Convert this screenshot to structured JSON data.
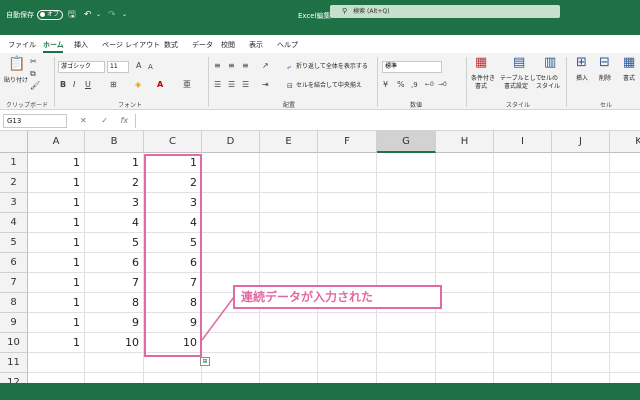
{
  "titlebar": {
    "autosave_label": "自動保存",
    "autosave_state": "オフ",
    "window_title": "Excel編集",
    "search_placeholder": "検索 (Alt+Q)"
  },
  "menu": [
    "ファイル",
    "ホーム",
    "挿入",
    "ページ レイアウト",
    "数式",
    "データ",
    "校閲",
    "表示",
    "ヘルプ"
  ],
  "menu_active": "ホーム",
  "ribbon": {
    "clipboard": {
      "paste": "貼り付け",
      "label": "クリップボード"
    },
    "font": {
      "name": "游ゴシック",
      "size": "11",
      "label": "フォント"
    },
    "alignment": {
      "wrap": "折り返して全体を表示する",
      "merge": "セルを結合して中央揃え",
      "label": "配置"
    },
    "number": {
      "format": "標準",
      "label": "数値"
    },
    "styles": {
      "conditional_1": "条件付き",
      "conditional_2": "書式",
      "table_1": "テーブルとして",
      "table_2": "書式設定",
      "cell_1": "セルの",
      "cell_2": "スタイル",
      "label": "スタイル"
    },
    "cells": {
      "insert": "挿入",
      "delete": "削除",
      "format": "書式",
      "label": "セル"
    }
  },
  "formula_bar": {
    "name_box": "G13",
    "fx": "fx",
    "value": ""
  },
  "columns": [
    "A",
    "B",
    "C",
    "D",
    "E",
    "F",
    "G",
    "H",
    "I",
    "J",
    "K"
  ],
  "selected_column": "G",
  "rows": [
    {
      "n": "1",
      "A": "1",
      "B": "1",
      "C": "1"
    },
    {
      "n": "2",
      "A": "1",
      "B": "2",
      "C": "2"
    },
    {
      "n": "3",
      "A": "1",
      "B": "3",
      "C": "3"
    },
    {
      "n": "4",
      "A": "1",
      "B": "4",
      "C": "4"
    },
    {
      "n": "5",
      "A": "1",
      "B": "5",
      "C": "5"
    },
    {
      "n": "6",
      "A": "1",
      "B": "6",
      "C": "6"
    },
    {
      "n": "7",
      "A": "1",
      "B": "7",
      "C": "7"
    },
    {
      "n": "8",
      "A": "1",
      "B": "8",
      "C": "8"
    },
    {
      "n": "9",
      "A": "1",
      "B": "9",
      "C": "9"
    },
    {
      "n": "10",
      "A": "1",
      "B": "10",
      "C": "10"
    },
    {
      "n": "11",
      "A": "",
      "B": "",
      "C": ""
    },
    {
      "n": "12",
      "A": "",
      "B": "",
      "C": ""
    }
  ],
  "callout_text": "連続データが入力された",
  "colors": {
    "excel_green": "#1e7145",
    "highlight_pink": "#e26aa3"
  }
}
